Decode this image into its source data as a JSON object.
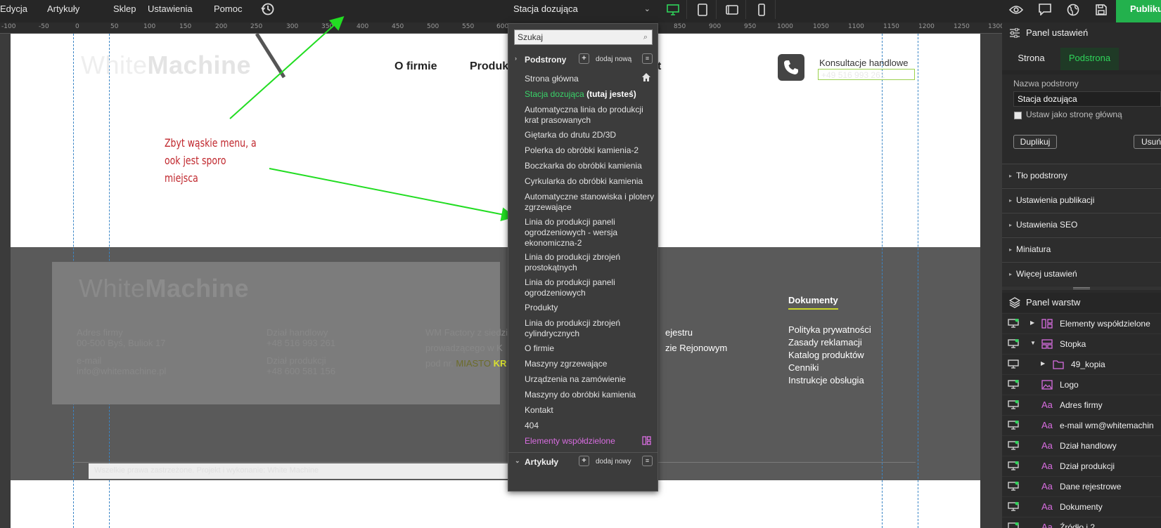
{
  "top_menu": {
    "items": [
      "Edycja",
      "Artykuły",
      "Sklep",
      "Ustawienia",
      "Pomoc"
    ],
    "history_icon": "history-icon"
  },
  "page_selector": {
    "current": "Stacja dozująca"
  },
  "devices": [
    "desktop-icon",
    "tablet-icon",
    "tablet-landscape-icon",
    "mobile-icon"
  ],
  "right_tools": [
    "preview-icon",
    "comment-icon",
    "globe-icon",
    "save-icon"
  ],
  "publish_label": "Publiku",
  "ruler": {
    "labels": [
      "-100",
      "-50",
      "0",
      "50",
      "100",
      "150",
      "200",
      "250",
      "300",
      "350",
      "400",
      "450",
      "500",
      "550",
      "600",
      "850",
      "900",
      "950",
      "1000",
      "1050",
      "1100",
      "1150",
      "1200",
      "1250",
      "1300"
    ]
  },
  "site": {
    "logo_light": "White",
    "logo_bold": "Machine",
    "nav": [
      "O firmie",
      "Produk",
      "t"
    ],
    "consult_label": "Konsultacje handlowe",
    "consult_value": "+49 516 993 261"
  },
  "annotation": {
    "lines": [
      "Zbyt wąskie menu, a",
      "ook jest sporo",
      "miejsca"
    ]
  },
  "footer": {
    "logo_light": "White",
    "logo_bold": "Machine",
    "address_title": "Adres firmy",
    "address": "00-500 Byś, Buliok 17",
    "email_title": "e-mail",
    "email": "info@whitemachine.pl",
    "sales_title": "Dział handlowy",
    "sales": "+48 516 993 261",
    "prod_title": "Dział produkcji",
    "prod": "+48 600 581 156",
    "info1": "WM Factory z siedzi",
    "info2": "prowadzącego w K",
    "info3": "pod nr.",
    "info3_gray": "MIASTO",
    "info3_hi": "KR",
    "reg1": "ejestru",
    "reg2": "zie Rejonowym",
    "docs_title": "Dokumenty",
    "docs": [
      "Polityka prywatności",
      "Zasady reklamacji",
      "Katalog produktów",
      "Cenniki",
      "Instrukcje obsługia"
    ],
    "bottom_text": "Wszelkie prawa zastrzeżone. Projekt i wykonanie: White Machine"
  },
  "dropdown": {
    "search_placeholder": "Szukaj",
    "section_pages": "Podstrony",
    "add_new": "dodaj nową",
    "current_suffix": "(tutaj jesteś)",
    "pages": [
      "Strona główna",
      "Stacja dozująca",
      "Automatyczna linia do produkcji krat prasowanych",
      "Giętarka do drutu 2D/3D",
      "Polerka do obróbki kamienia-2",
      "Boczkarka do obróbki kamienia",
      "Cyrkularka do obróbki kamienia",
      "Automatyczne stanowiska i plotery zgrzewające",
      "Linia do produkcji paneli ogrodzeniowych - wersja ekonomiczna-2",
      "Linia do produkcji zbrojeń prostokątnych",
      "Linia do produkcji paneli ogrodzeniowych",
      "Produkty",
      "Linia do produkcji zbrojeń cylindrycznych",
      "O firmie",
      "Maszyny zgrzewające",
      "Urządzenia na zamówienie",
      "Maszyny do obróbki kamienia",
      "Kontakt",
      "404",
      "Elementy współdzielone"
    ],
    "section_articles": "Artykuły",
    "add_new_articles": "dodaj nowy"
  },
  "settings_panel": {
    "title": "Panel ustawień",
    "tabs": [
      "Strona",
      "Podstrona"
    ],
    "name_label": "Nazwa podstrony",
    "name_value": "Stacja dozująca",
    "set_home_label": "Ustaw jako stronę główną",
    "duplicate_label": "Duplikuj",
    "delete_label": "Usuń",
    "sections": [
      "Tło podstrony",
      "Ustawienia publikacji",
      "Ustawienia SEO",
      "Miniatura",
      "Więcej ustawień"
    ]
  },
  "layers_panel": {
    "title": "Panel warstw",
    "layers": [
      {
        "name": "Elementy współdzielone",
        "icon": "shared-elements-icon"
      },
      {
        "name": "Stopka",
        "icon": "footer-layout-icon"
      },
      {
        "name": "49_kopia",
        "icon": "folder-icon"
      },
      {
        "name": "Logo",
        "icon": "image-icon"
      },
      {
        "name": "Adres firmy",
        "icon": "text-icon"
      },
      {
        "name": "e-mail wm@whitemachin",
        "icon": "text-icon"
      },
      {
        "name": "Dział handlowy",
        "icon": "text-icon"
      },
      {
        "name": "Dział produkcji",
        "icon": "text-icon"
      },
      {
        "name": "Dane rejestrowe",
        "icon": "text-icon"
      },
      {
        "name": "Dokumenty",
        "icon": "text-icon"
      },
      {
        "name": "Źródło i 2",
        "icon": "text-icon"
      }
    ]
  },
  "colors": {
    "accent_green": "#23b14d",
    "current_page": "#39d369",
    "shared": "#d86de0",
    "annotation": "#c0272d",
    "arrow": "#22dd22"
  }
}
